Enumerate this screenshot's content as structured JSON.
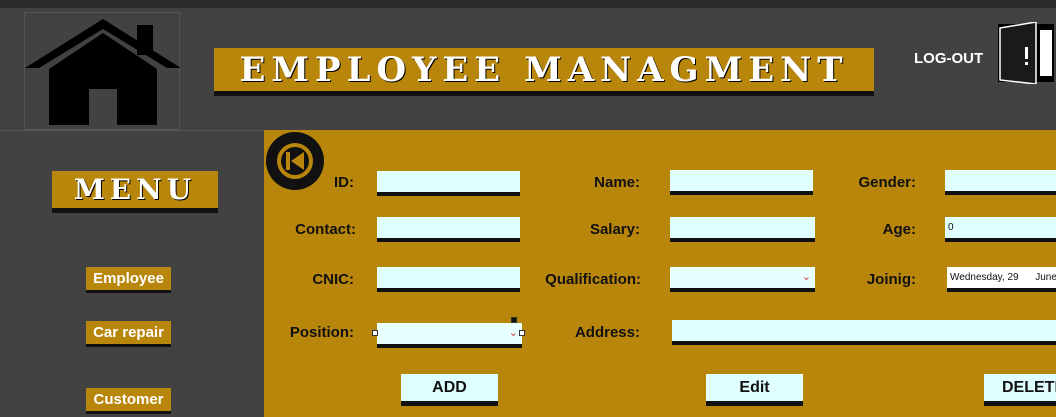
{
  "header": {
    "title": "EMPLOYEE MANAGMENT",
    "logout_label": "LOG-OUT",
    "home_icon": "home-icon",
    "door_icon": "door-exit-icon"
  },
  "sidebar": {
    "menu_title": "MENU",
    "items": [
      {
        "label": "Employee"
      },
      {
        "label": "Car repair"
      },
      {
        "label": "Customer"
      }
    ]
  },
  "form": {
    "back_icon": "back-arrow-icon",
    "labels": {
      "id": "ID:",
      "name": "Name:",
      "gender": "Gender:",
      "contact": "Contact:",
      "salary": "Salary:",
      "age": "Age:",
      "cnic": "CNIC:",
      "qualification": "Qualification:",
      "joining": "Joinig:",
      "position": "Position:",
      "address": "Address:"
    },
    "values": {
      "id": "",
      "name": "",
      "gender": "",
      "contact": "",
      "salary": "",
      "age": "0",
      "cnic": "",
      "qualification": "",
      "joining": "Wednesday, 29      June",
      "position": "",
      "address": ""
    }
  },
  "actions": {
    "add": "ADD",
    "edit": "Edit",
    "delete": "DELETE"
  },
  "colors": {
    "accent": "#b8860b",
    "background": "#424242",
    "field": "#e0ffff"
  }
}
